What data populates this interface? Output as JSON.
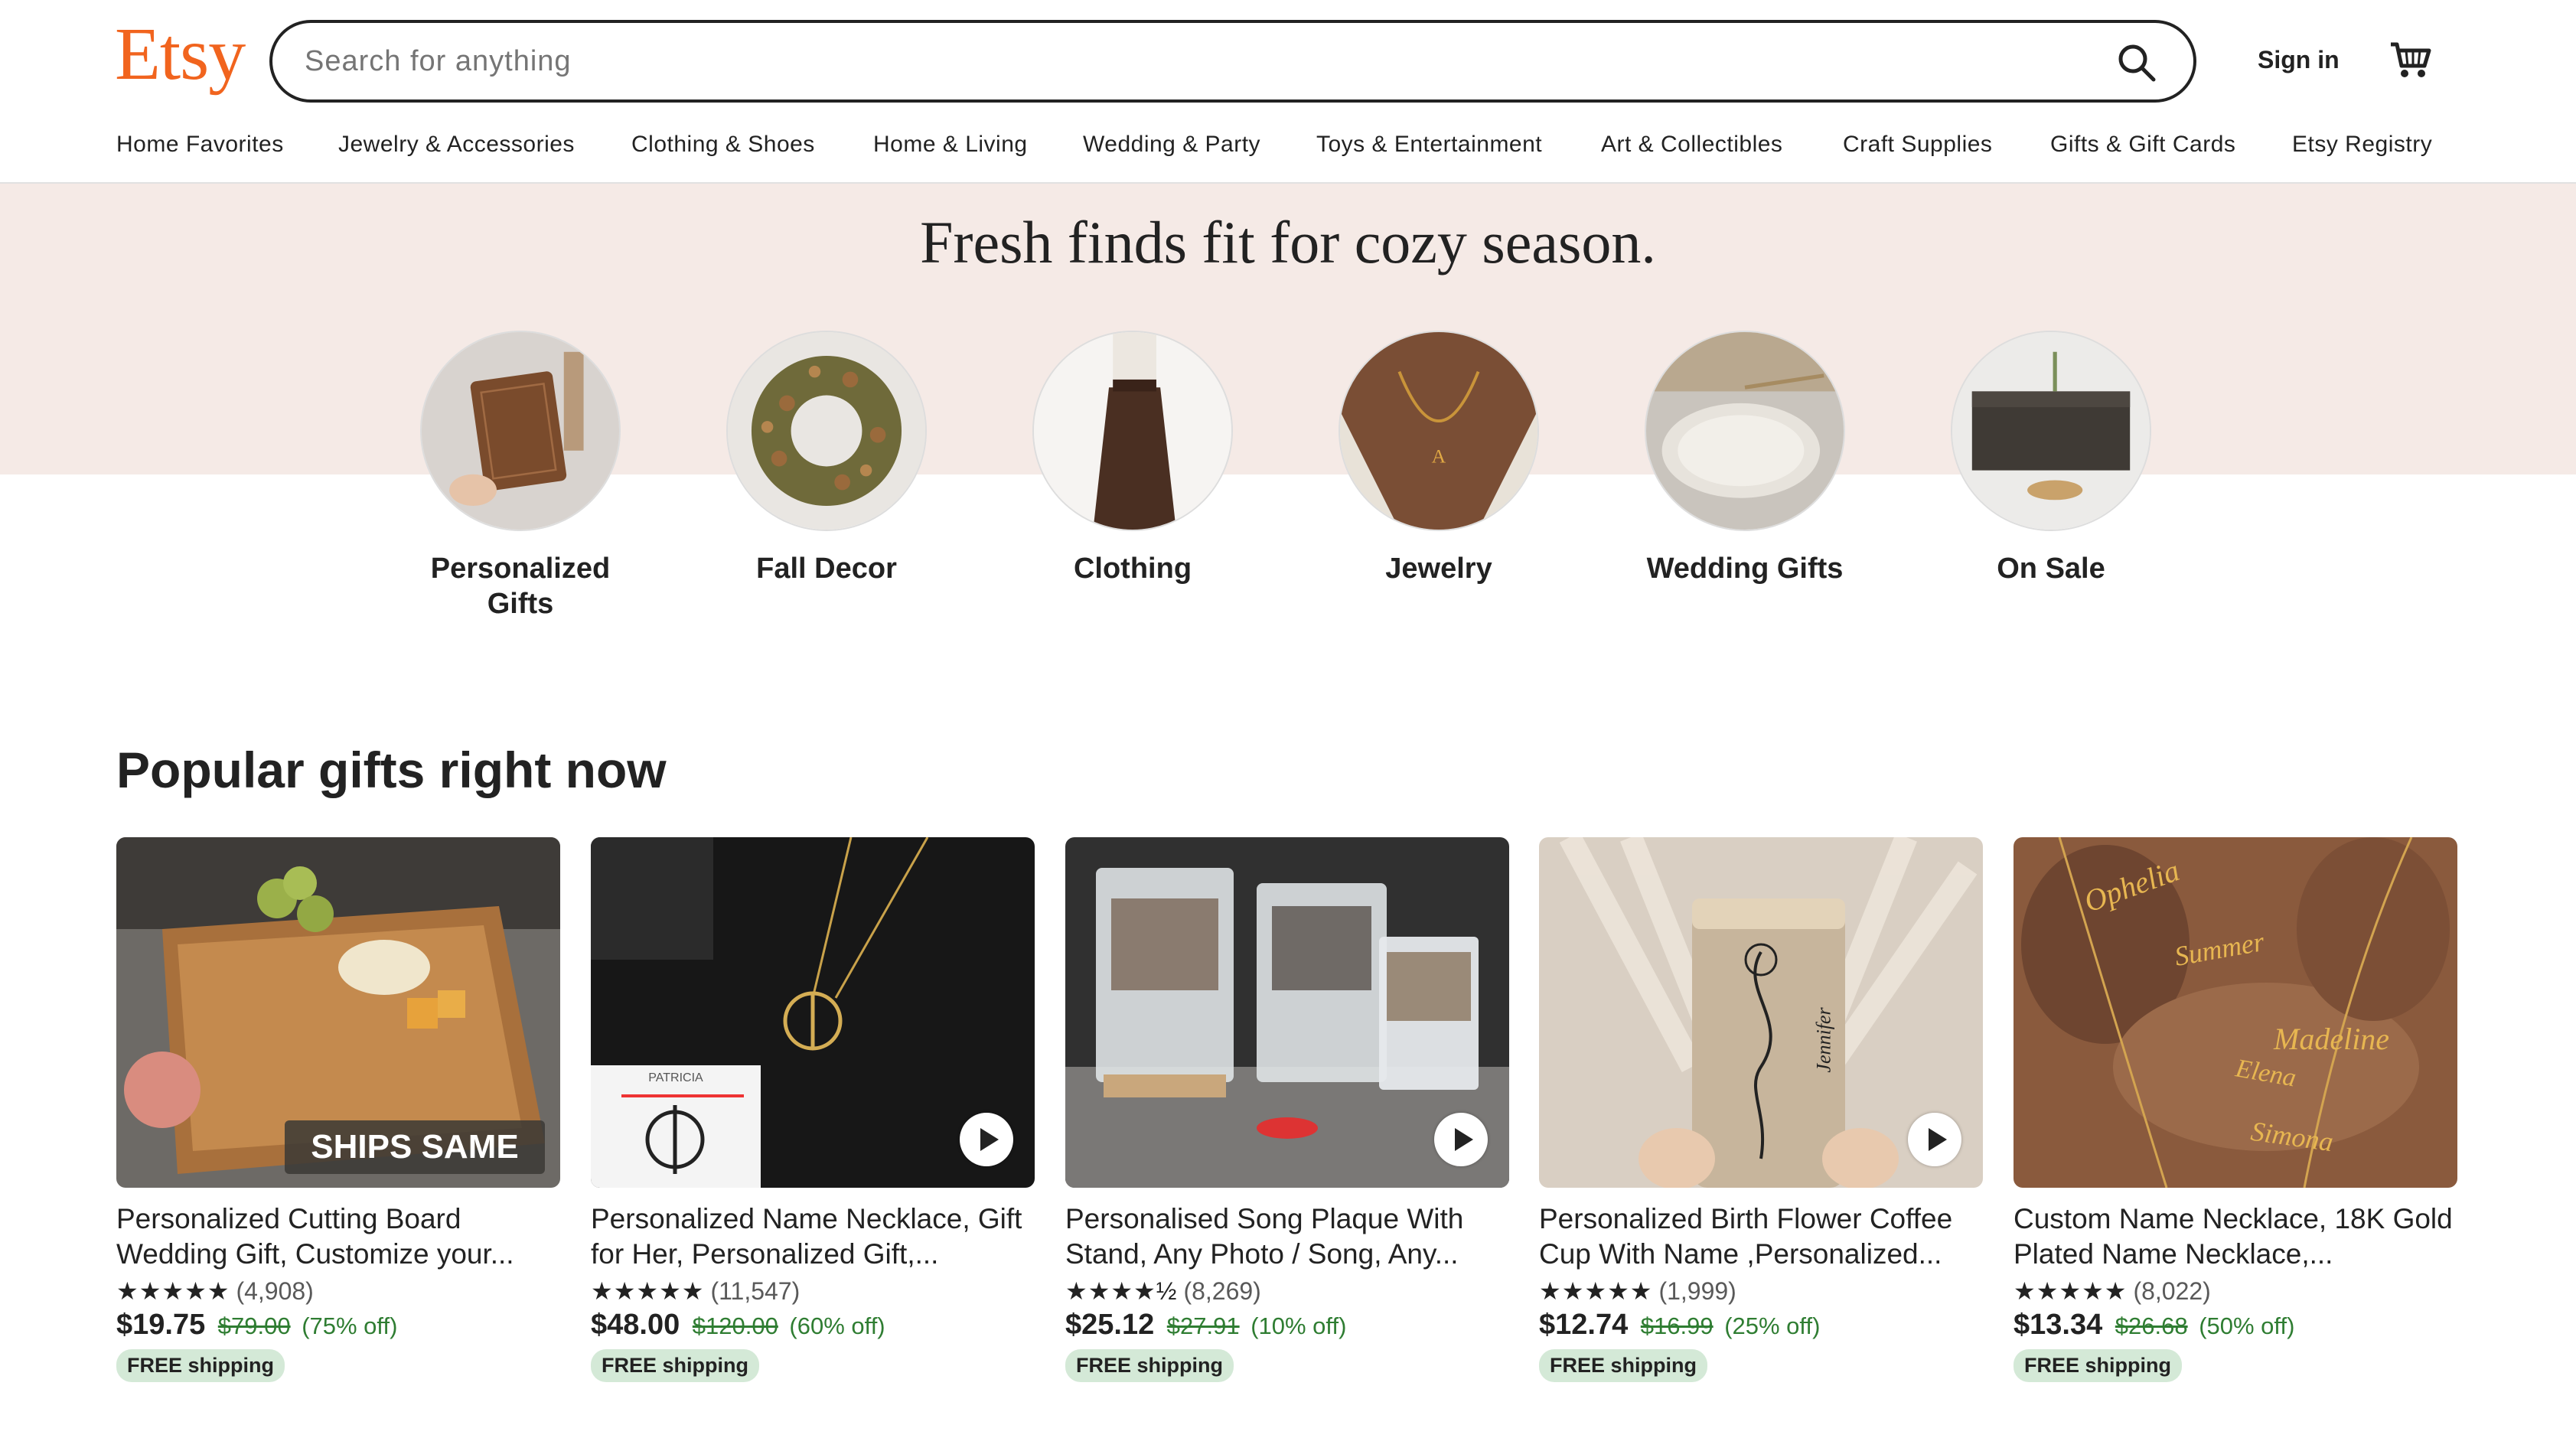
{
  "header": {
    "logo": "Etsy",
    "search": {
      "placeholder": "Search for anything",
      "value": ""
    },
    "sign_in": "Sign in",
    "cart_icon": "shopping-cart-icon",
    "search_icon": "search-icon"
  },
  "nav": [
    "Home Favorites",
    "Jewelry & Accessories",
    "Clothing & Shoes",
    "Home & Living",
    "Wedding & Party",
    "Toys & Entertainment",
    "Art & Collectibles",
    "Craft Supplies",
    "Gifts & Gift Cards",
    "Etsy Registry"
  ],
  "hero": {
    "title": "Fresh finds fit for cozy season.",
    "categories": [
      {
        "label": "Personalized Gifts"
      },
      {
        "label": "Fall Decor"
      },
      {
        "label": "Clothing"
      },
      {
        "label": "Jewelry"
      },
      {
        "label": "Wedding Gifts"
      },
      {
        "label": "On Sale"
      }
    ]
  },
  "popular": {
    "title": "Popular gifts right now",
    "items": [
      {
        "title": "Personalized Cutting Board Wedding Gift, Customize your...",
        "stars": "★★★★★",
        "rating_count": "(4,908)",
        "price": "$19.75",
        "original_price": "$79.00",
        "discount": "(75% off)",
        "badge": "FREE shipping",
        "overlay_text": "SHIPS SAME DAY!",
        "has_video": false
      },
      {
        "title": "Personalized Name Necklace, Gift for Her, Personalized Gift,...",
        "stars": "★★★★★",
        "rating_count": "(11,547)",
        "price": "$48.00",
        "original_price": "$120.00",
        "discount": "(60% off)",
        "badge": "FREE shipping",
        "overlay_text": "PATRICIA",
        "has_video": true
      },
      {
        "title": "Personalised Song Plaque With Stand, Any Photo / Song, Any...",
        "stars": "★★★★½",
        "rating_count": "(8,269)",
        "price": "$25.12",
        "original_price": "$27.91",
        "discount": "(10% off)",
        "badge": "FREE shipping",
        "has_video": true
      },
      {
        "title": "Personalized Birth Flower Coffee Cup With Name ,Personalized...",
        "stars": "★★★★★",
        "rating_count": "(1,999)",
        "price": "$12.74",
        "original_price": "$16.99",
        "discount": "(25% off)",
        "badge": "FREE shipping",
        "overlay_text": "Jennifer",
        "has_video": true
      },
      {
        "title": "Custom Name Necklace, 18K Gold Plated Name Necklace,...",
        "stars": "★★★★★",
        "rating_count": "(8,022)",
        "price": "$13.34",
        "original_price": "$26.68",
        "discount": "(50% off)",
        "badge": "FREE shipping",
        "overlay_names": [
          "Ophelia",
          "Summer",
          "Madeline",
          "Elena",
          "Simona"
        ],
        "has_video": false
      }
    ]
  },
  "colors": {
    "brand": "#F1641E",
    "hero_bg": "#F5EAE6",
    "sale_green": "#2f7d32",
    "shipping_badge": "#D4E9D7"
  }
}
